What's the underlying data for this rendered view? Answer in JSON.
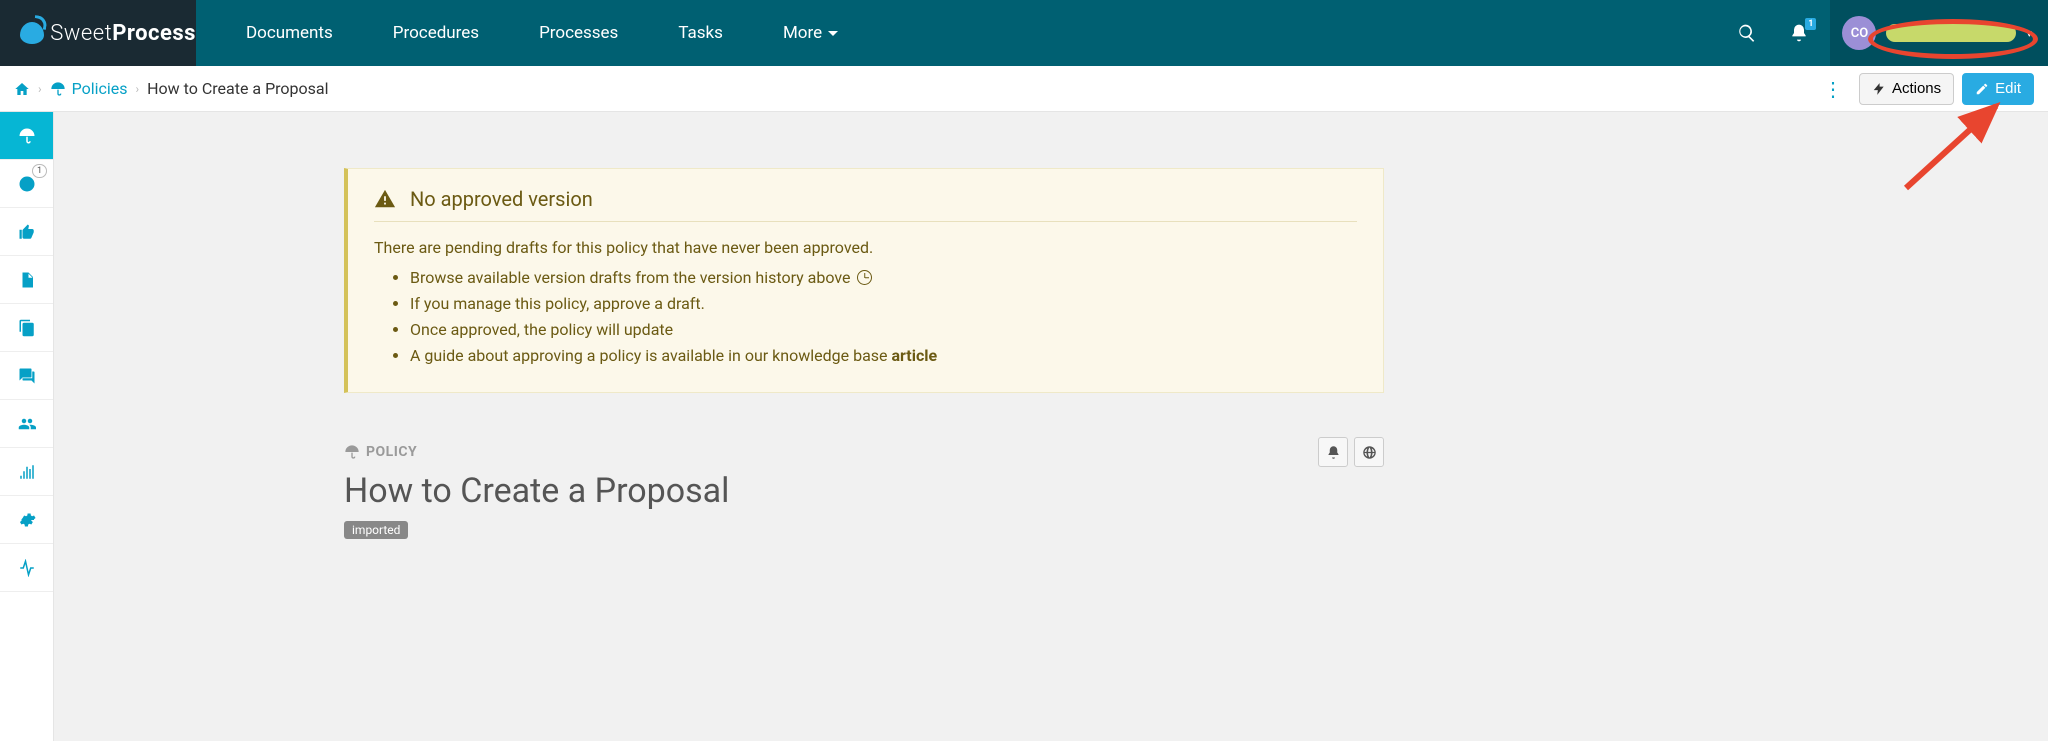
{
  "brand": {
    "name_light": "Sweet",
    "name_bold": "Process"
  },
  "nav": {
    "items": [
      "Documents",
      "Procedures",
      "Processes",
      "Tasks"
    ],
    "more": "More"
  },
  "notifications": {
    "count": "1"
  },
  "user": {
    "initials": "CO"
  },
  "breadcrumb": {
    "policies": "Policies",
    "current": "How to Create a Proposal"
  },
  "actions": {
    "actions_label": "Actions",
    "edit_label": "Edit"
  },
  "sidebar": {
    "badge": "1"
  },
  "alert": {
    "title": "No approved version",
    "intro": "There are pending drafts for this policy that have never been approved.",
    "bullet1": "Browse available version drafts from the version history above",
    "bullet2": "If you manage this policy, approve a draft.",
    "bullet3": "Once approved, the policy will update",
    "bullet4_pre": "A guide about approving a policy is available in our knowledge base ",
    "bullet4_link": "article"
  },
  "document": {
    "type": "POLICY",
    "title": "How to Create a Proposal",
    "tag": "imported"
  }
}
